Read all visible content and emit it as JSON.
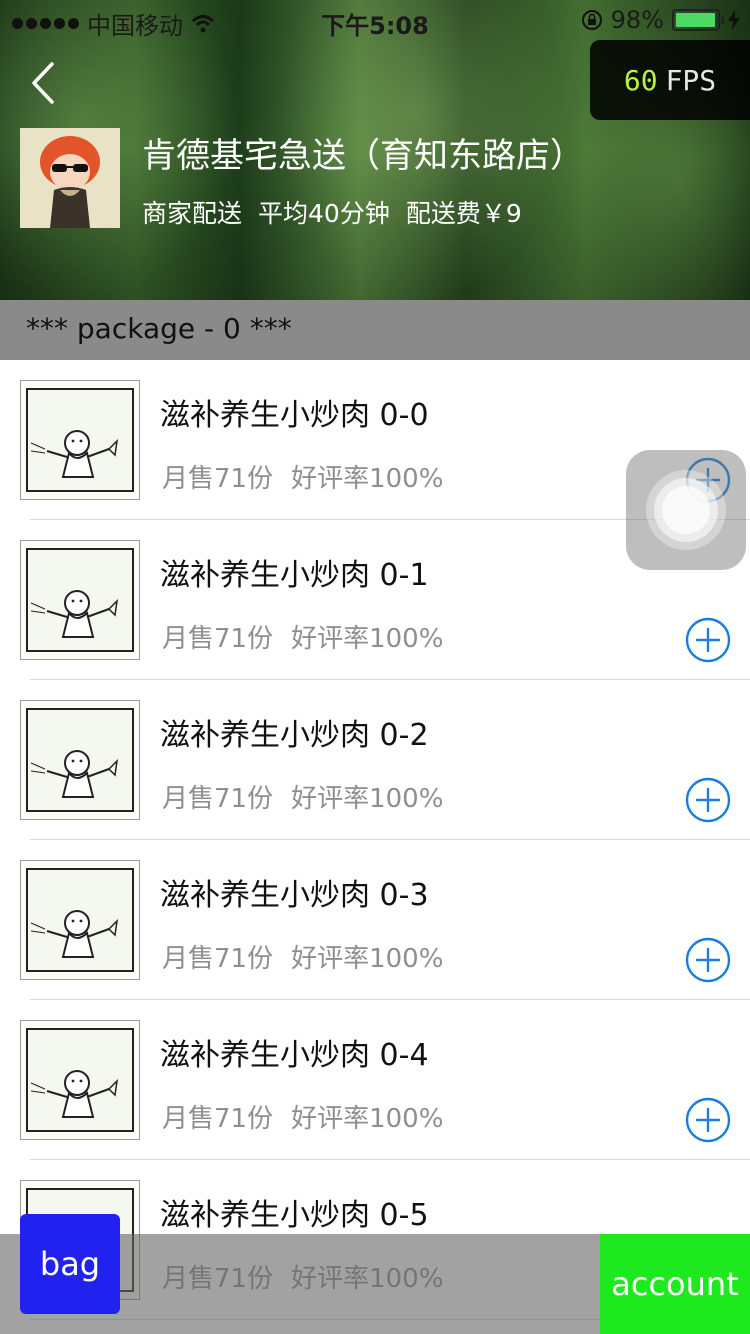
{
  "status_bar": {
    "carrier": "中国移动",
    "time": "下午5:08",
    "battery": "98%",
    "battery_level": 0.98
  },
  "fps": {
    "value": "60",
    "label": "FPS"
  },
  "shop": {
    "name": "肯德基宅急送（育知东路店）",
    "delivery": "商家配送",
    "avg_time": "平均40分钟",
    "fee": "配送费￥9"
  },
  "section": {
    "title": "*** package - 0 ***"
  },
  "products": [
    {
      "name": "滋补养生小炒肉 0-0",
      "sales": "月售71份",
      "rating": "好评率100%"
    },
    {
      "name": "滋补养生小炒肉 0-1",
      "sales": "月售71份",
      "rating": "好评率100%"
    },
    {
      "name": "滋补养生小炒肉 0-2",
      "sales": "月售71份",
      "rating": "好评率100%"
    },
    {
      "name": "滋补养生小炒肉 0-3",
      "sales": "月售71份",
      "rating": "好评率100%"
    },
    {
      "name": "滋补养生小炒肉 0-4",
      "sales": "月售71份",
      "rating": "好评率100%"
    },
    {
      "name": "滋补养生小炒肉 0-5",
      "sales": "月售71份",
      "rating": "好评率100%"
    }
  ],
  "bottom_bar": {
    "bag_label": "bag",
    "account_label": "account"
  },
  "colors": {
    "accent_blue": "#1a7ee0",
    "bag_blue": "#2222f0",
    "account_green": "#1ee81e",
    "fps_green": "#b9f23a"
  }
}
